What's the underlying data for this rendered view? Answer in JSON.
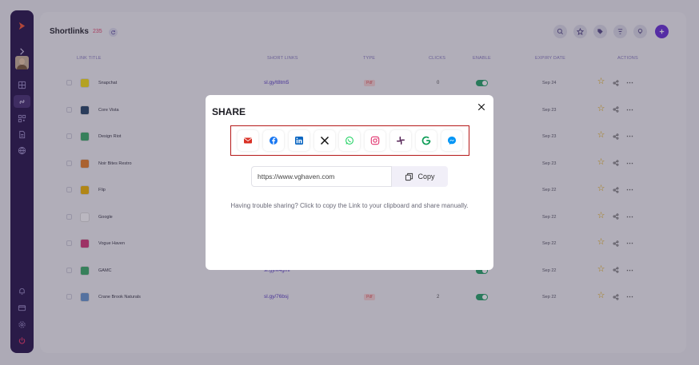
{
  "header": {
    "title": "Shortlinks",
    "count": "235"
  },
  "table": {
    "columns": [
      "LINK TITLE",
      "SHORT LINKS",
      "TYPE",
      "CLICKS",
      "ENABLE",
      "EXPIRY DATE",
      "ACTIONS"
    ],
    "rows": [
      {
        "title": "Snapchat",
        "short": "sl.gy/t8tm5",
        "type": "Pdf",
        "clicks": "0",
        "expiry": "Sep 24",
        "logo_color": "#f7e017"
      },
      {
        "title": "Core Vista",
        "short": "",
        "type": "",
        "clicks": "",
        "expiry": "Sep 23",
        "logo_color": "#2b4a6b"
      },
      {
        "title": "Design Riot",
        "short": "",
        "type": "",
        "clicks": "",
        "expiry": "Sep 23",
        "logo_color": "#3fae6a"
      },
      {
        "title": "Noir Bites Restro",
        "short": "",
        "type": "",
        "clicks": "",
        "expiry": "Sep 23",
        "logo_color": "#e8822b"
      },
      {
        "title": "Flip",
        "short": "",
        "type": "",
        "clicks": "",
        "expiry": "Sep 22",
        "logo_color": "#f2b705"
      },
      {
        "title": "Google",
        "short": "",
        "type": "",
        "clicks": "",
        "expiry": "Sep 22",
        "logo_color": "#ffffff"
      },
      {
        "title": "Vogue Haven",
        "short": "",
        "type": "",
        "clicks": "",
        "expiry": "Sep 22",
        "logo_color": "#d43b7a"
      },
      {
        "title": "GAMC",
        "short": "sl.gy/k4gml",
        "type": "",
        "clicks": "",
        "expiry": "Sep 22",
        "logo_color": "#3fae6a"
      },
      {
        "title": "Crane Brook Naturals",
        "short": "sl.gy/76bsj",
        "type": "Pdf",
        "clicks": "2",
        "expiry": "Sep 22",
        "logo_color": "#6a9ad0"
      }
    ]
  },
  "modal": {
    "title": "SHARE",
    "url_value": "https://www.vghaven.com",
    "copy_label": "Copy",
    "hint": "Having trouble sharing? Click to copy the Link to your clipboard and share manually."
  },
  "colors": {
    "accent": "#6b34d6",
    "sidebar": "#2c1a4f",
    "highlight_border": "#b51919"
  },
  "icons": [
    "email-icon",
    "facebook-icon",
    "linkedin-icon",
    "x-icon",
    "whatsapp-icon",
    "instagram-icon",
    "slack-icon",
    "google-icon",
    "messenger-icon"
  ]
}
